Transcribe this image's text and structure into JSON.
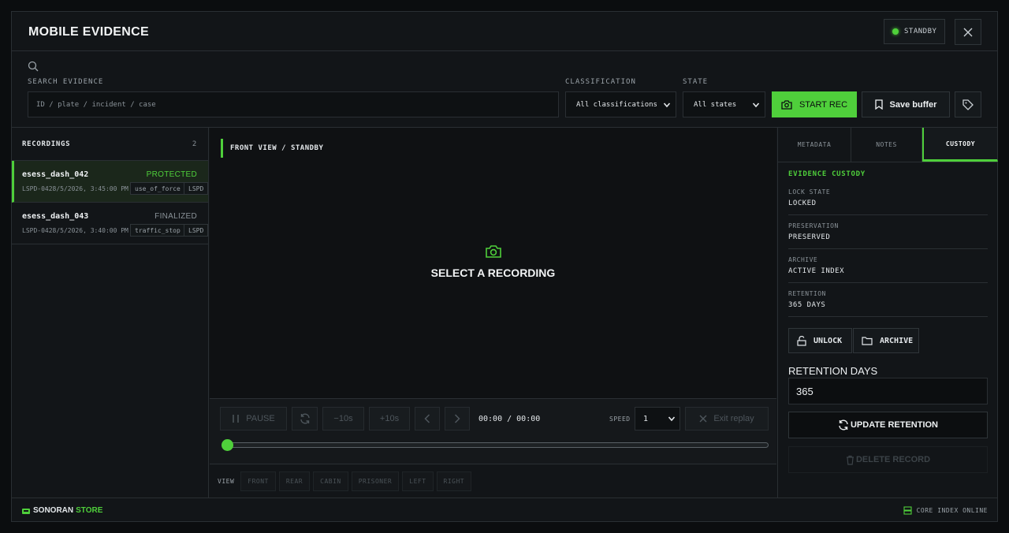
{
  "header": {
    "title": "MOBILE EVIDENCE",
    "status": "STANDBY",
    "status_color": "#4fd13a"
  },
  "filters": {
    "search_label": "SEARCH EVIDENCE",
    "search_placeholder": "ID / plate / incident / case",
    "classification_label": "CLASSIFICATION",
    "classification_value": "All classifications",
    "state_label": "STATE",
    "state_value": "All states",
    "start_rec_label": "START REC",
    "save_buffer_label": "Save buffer"
  },
  "recordings": {
    "title": "RECORDINGS",
    "count": "2",
    "items": [
      {
        "name": "esess_dash_042",
        "status": "PROTECTED",
        "status_color": "#4fcf3b",
        "meta": "LSPD-0428/5/2026, 3:45:00 PM",
        "tag": "use_of_force",
        "agency": "LSPD",
        "active": true
      },
      {
        "name": "esess_dash_043",
        "status": "FINALIZED",
        "status_color": "#8a9298",
        "meta": "LSPD-0428/5/2026, 3:40:00 PM",
        "tag": "traffic_stop",
        "agency": "LSPD",
        "active": false
      }
    ]
  },
  "viewer": {
    "view_label": "FRONT VIEW / STANDBY",
    "placeholder": "SELECT A RECORDING"
  },
  "controls": {
    "pause": "PAUSE",
    "back10": "−10s",
    "fwd10": "+10s",
    "time": "00:00 / 00:00",
    "speed_label": "SPEED",
    "speed_value": "1",
    "exit_replay": "Exit replay",
    "progress": 0
  },
  "views": {
    "label": "VIEW",
    "items": [
      "FRONT",
      "REAR",
      "CABIN",
      "PRISONER",
      "LEFT",
      "RIGHT"
    ]
  },
  "right": {
    "tabs": [
      "METADATA",
      "NOTES",
      "CUSTODY"
    ],
    "active_tab": "CUSTODY",
    "section_title": "EVIDENCE CUSTODY",
    "fields": [
      {
        "key": "LOCK STATE",
        "value": "LOCKED"
      },
      {
        "key": "PRESERVATION",
        "value": "PRESERVED"
      },
      {
        "key": "ARCHIVE",
        "value": "ACTIVE INDEX"
      },
      {
        "key": "RETENTION",
        "value": "365 DAYS"
      }
    ],
    "unlock_label": "UNLOCK",
    "archive_label": "ARCHIVE",
    "retention_days_label": "RETENTION DAYS",
    "retention_days_value": "365",
    "update_label": "UPDATE RETENTION",
    "delete_label": "DELETE RECORD"
  },
  "footer": {
    "brand_a": "SONORAN",
    "brand_b": "STORE",
    "status": "CORE INDEX ONLINE"
  },
  "colors": {
    "accent": "#4fcf3b",
    "bg": "#121518"
  }
}
